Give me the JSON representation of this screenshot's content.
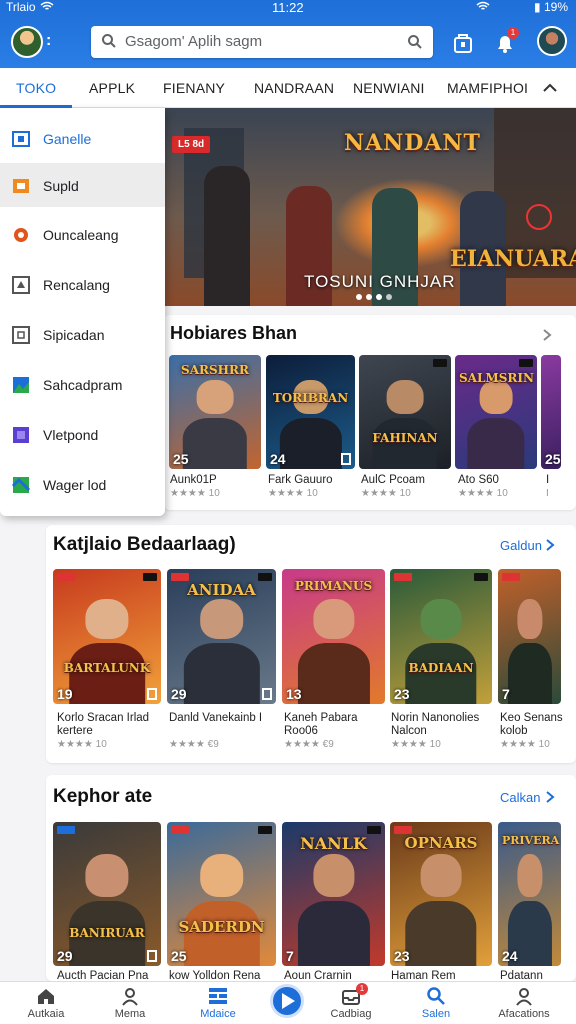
{
  "status_bar": {
    "left": "Trlaio",
    "time": "11:22",
    "battery": "19%"
  },
  "header": {
    "search_placeholder": "Gsagom' Aplih sagm",
    "notification_count": "1"
  },
  "tabs": [
    "TOKO",
    "APPLK",
    "FIENANY",
    "NANDRAAN",
    "NENWIANI",
    "MAMFIPHOI"
  ],
  "menu": {
    "items": [
      {
        "label": "Ganelle",
        "icon": "frame-icon",
        "color": "#1d6ed8"
      },
      {
        "label": "Supld",
        "icon": "tile-icon",
        "color": "#f08a1e"
      },
      {
        "label": "Ouncaleang",
        "icon": "disc-icon",
        "color": "#e2541a"
      },
      {
        "label": "Rencalang",
        "icon": "puzzle-icon",
        "color": "#555555"
      },
      {
        "label": "Sipicadan",
        "icon": "cube-icon",
        "color": "#555555"
      },
      {
        "label": "Sahcadpram",
        "icon": "landscape-icon",
        "color": "#2aa94a"
      },
      {
        "label": "Vletpond",
        "icon": "photo-icon",
        "color": "#5b3fd0"
      },
      {
        "label": "Wager lod",
        "icon": "map-icon",
        "color": "#2aa94a"
      }
    ]
  },
  "banner": {
    "badge": "L5 8d",
    "title_top": "NANDANT",
    "title_big": "EIANUARA",
    "subtitle": "TOSUNI GNHJAR"
  },
  "section1": {
    "title": "Hobiares Bhan",
    "games": [
      {
        "art_title": "SARSHRR",
        "num": "25",
        "name": "Aunk01P",
        "rating": "★★★★ 10"
      },
      {
        "art_title": "TORIBRAN",
        "num": "24",
        "name": "Fark Gauuro",
        "rating": "★★★★ 10"
      },
      {
        "art_title": "FAHINAN",
        "num": "",
        "name": "AulC Pcoam",
        "rating": "★★★★ 10"
      },
      {
        "art_title": "SALMSRIN",
        "num": "",
        "name": "Ato S60",
        "rating": "★★★★ 10"
      },
      {
        "art_title": "",
        "num": "25",
        "name": "I",
        "rating": "I"
      }
    ]
  },
  "section2": {
    "title": "Katjlaio Bedaarlaag)",
    "more": "Galdun",
    "games": [
      {
        "art_title": "BARTALUNK",
        "num": "19",
        "name": "Korlo Sracan Irlad kertere",
        "rating": "★★★★ 10"
      },
      {
        "art_title": "ANIDAA",
        "num": "29",
        "name": "Danld Vanekainb I",
        "rating": "★★★★ €9"
      },
      {
        "art_title": "PRIMANUS",
        "num": "13",
        "name": "Kaneh Pabara Roo06",
        "rating": "★★★★ €9"
      },
      {
        "art_title": "BADIAAN",
        "num": "23",
        "name": "Norin Nanonolies Nalcon",
        "rating": "★★★★ 10"
      },
      {
        "art_title": "",
        "num": "7",
        "name": "Keo Senans kolob",
        "rating": "★★★★ 10"
      }
    ]
  },
  "section3": {
    "title": "Kephor ate",
    "more": "Calkan",
    "games": [
      {
        "art_title": "BANIRUAR",
        "num": "29",
        "name": "Aucth Pacian Pna",
        "rating": ""
      },
      {
        "art_title": "SADERDN",
        "num": "25",
        "name": "kow Yolldon Rena",
        "rating": ""
      },
      {
        "art_title": "NANLK",
        "num": "7",
        "name": "Aoun Crarnin",
        "rating": ""
      },
      {
        "art_title": "OPNARS",
        "num": "23",
        "name": "Haman Rem",
        "rating": ""
      },
      {
        "art_title": "PRIVERA",
        "num": "24",
        "name": "Pdatann",
        "rating": ""
      }
    ]
  },
  "bottom_nav": [
    "Autkaia",
    "Mema",
    "Mdaice",
    "",
    "Cadbiag",
    "Salen",
    "Afacations"
  ],
  "bottom_nav_badge": "1",
  "colors": {
    "brand": "#1d6ed8",
    "header": "#2a7ee6"
  }
}
